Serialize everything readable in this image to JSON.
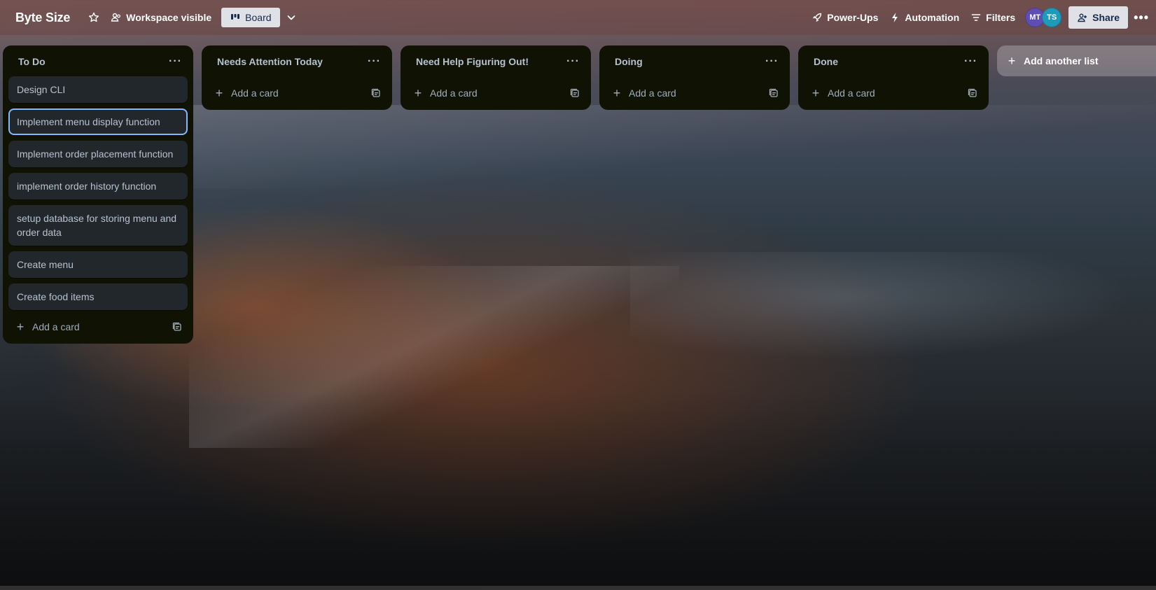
{
  "header": {
    "board_title": "Byte Size",
    "visibility_label": "Workspace visible",
    "view_label": "Board",
    "powerups_label": "Power-Ups",
    "automation_label": "Automation",
    "filters_label": "Filters",
    "share_label": "Share",
    "members": [
      {
        "initials": "MT",
        "color": "#5e4db2"
      },
      {
        "initials": "TS",
        "color": "#1d9bb8"
      }
    ]
  },
  "lists": [
    {
      "title": "To Do",
      "cards": [
        "Design CLI",
        "Implement menu display function",
        "Implement order placement function",
        "implement order history function",
        "setup database for storing menu and order data",
        "Create menu",
        "Create food items"
      ],
      "add_card_label": "Add a card"
    },
    {
      "title": "Needs Attention Today",
      "cards": [],
      "add_card_label": "Add a card"
    },
    {
      "title": "Need Help Figuring Out!",
      "cards": [],
      "add_card_label": "Add a card"
    },
    {
      "title": "Doing",
      "cards": [],
      "add_card_label": "Add a card"
    },
    {
      "title": "Done",
      "cards": [],
      "add_card_label": "Add a card"
    }
  ],
  "add_list_label": "Add another list",
  "selected_card": "Implement menu display function"
}
